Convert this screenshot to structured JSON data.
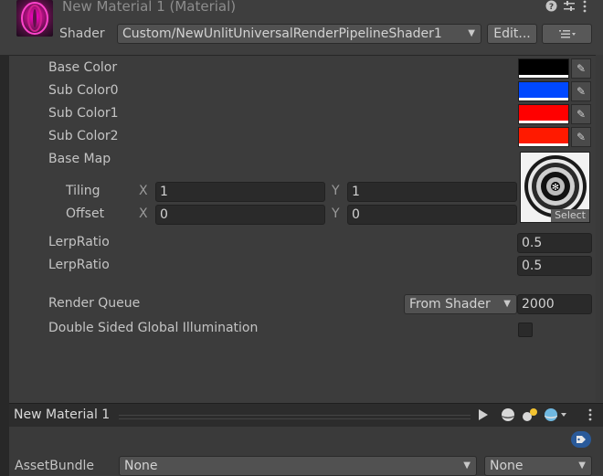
{
  "header": {
    "title": "New Material 1 (Material)",
    "shader_label": "Shader",
    "shader_value": "Custom/NewUnlitUniversalRenderPipelineShader1",
    "edit_button": "Edit...",
    "icons": [
      "help-icon",
      "preset-icon",
      "kebab-menu-icon",
      "list-menu-icon"
    ]
  },
  "properties": {
    "base_color": {
      "label": "Base Color",
      "color": "#000000"
    },
    "sub_color0": {
      "label": "Sub Color0",
      "color": "#0048ff"
    },
    "sub_color1": {
      "label": "Sub Color1",
      "color": "#ff0000"
    },
    "sub_color2": {
      "label": "Sub Color2",
      "color": "#ff1a00"
    },
    "base_map": {
      "label": "Base Map",
      "select_label": "Select"
    },
    "tiling": {
      "label": "Tiling",
      "x_label": "X",
      "x": "1",
      "y_label": "Y",
      "y": "1"
    },
    "offset": {
      "label": "Offset",
      "x_label": "X",
      "x": "0",
      "y_label": "Y",
      "y": "0"
    },
    "lerp1": {
      "label": "LerpRatio",
      "value": "0.5"
    },
    "lerp2": {
      "label": "LerpRatio",
      "value": "0.5"
    },
    "render_queue": {
      "label": "Render Queue",
      "mode": "From Shader",
      "value": "2000"
    },
    "double_sided": {
      "label": "Double Sided Global Illumination",
      "checked": false
    }
  },
  "preview": {
    "title": "New Material 1",
    "icons": [
      "play-icon",
      "sphere-icon",
      "lighting-icon",
      "shape-sphere-icon"
    ]
  },
  "asset_bundle": {
    "label": "AssetBundle",
    "value": "None",
    "variant": "None"
  }
}
